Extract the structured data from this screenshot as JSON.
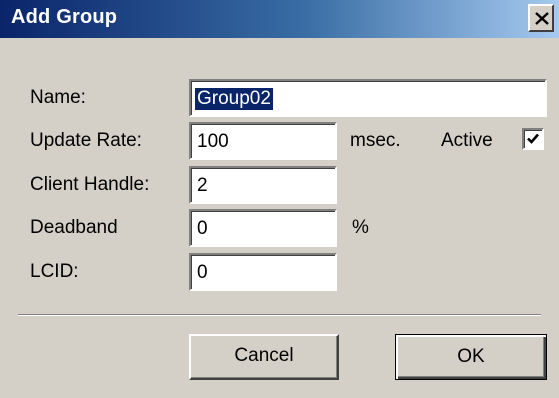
{
  "window": {
    "title": "Add Group",
    "close_icon": "close-icon"
  },
  "form": {
    "name": {
      "label": "Name:",
      "value": "Group02"
    },
    "update_rate": {
      "label": "Update Rate:",
      "value": "100",
      "unit": "msec."
    },
    "active": {
      "label": "Active",
      "checked": true
    },
    "client_handle": {
      "label": "Client Handle:",
      "value": "2"
    },
    "deadband": {
      "label": "Deadband",
      "value": "0",
      "unit": "%"
    },
    "lcid": {
      "label": "LCID:",
      "value": "0"
    }
  },
  "buttons": {
    "cancel": "Cancel",
    "ok": "OK"
  },
  "colors": {
    "titlebar_start": "#0a246a",
    "titlebar_end": "#a6caf0",
    "face": "#d4d0c8"
  }
}
